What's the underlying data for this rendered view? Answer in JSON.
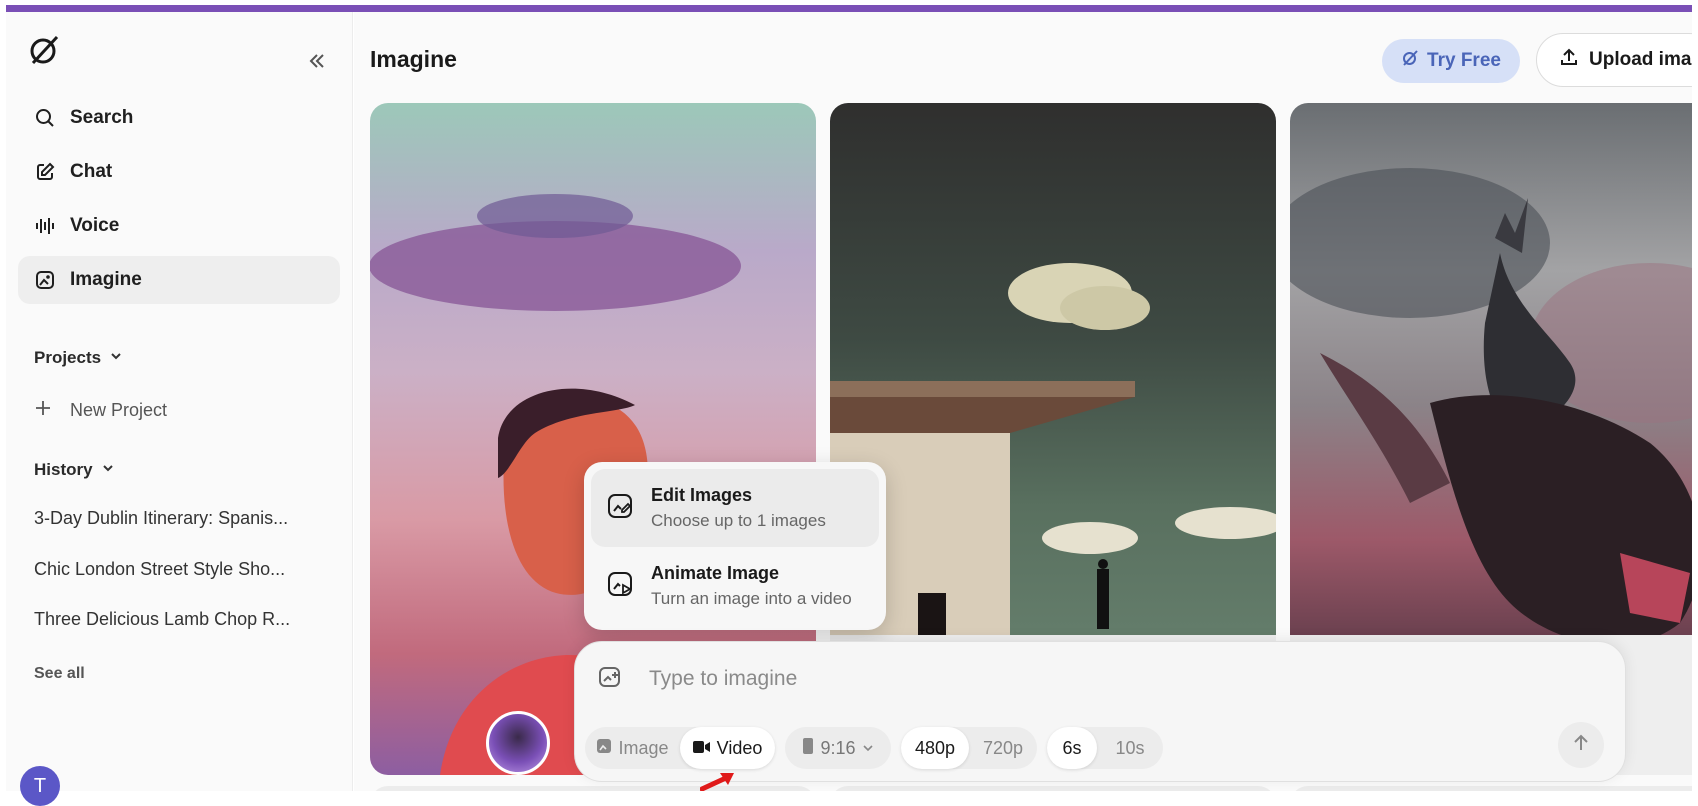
{
  "sidebar": {
    "nav": [
      {
        "label": "Search",
        "icon": "search-icon"
      },
      {
        "label": "Chat",
        "icon": "chat-edit-icon"
      },
      {
        "label": "Voice",
        "icon": "voice-wave-icon"
      },
      {
        "label": "Imagine",
        "icon": "imagine-icon",
        "active": true
      }
    ],
    "projects_label": "Projects",
    "new_project_label": "New Project",
    "history_label": "History",
    "history_items": [
      "3-Day Dublin Itinerary: Spanis...",
      "Chic London Street Style Sho...",
      "Three Delicious Lamb Chop R..."
    ],
    "see_all_label": "See all",
    "user_initial": "T"
  },
  "header": {
    "title": "Imagine",
    "try_free_label": "Try Free",
    "upload_label": "Upload image"
  },
  "menu": {
    "items": [
      {
        "title": "Edit Images",
        "subtitle": "Choose up to 1 images"
      },
      {
        "title": "Animate Image",
        "subtitle": "Turn an image into a video"
      }
    ]
  },
  "composer": {
    "placeholder": "Type to imagine",
    "mode": {
      "image_label": "Image",
      "video_label": "Video",
      "selected": "Video"
    },
    "aspect_label": "9:16",
    "resolution": {
      "options": [
        "480p",
        "720p"
      ],
      "selected": "480p"
    },
    "duration": {
      "options": [
        "6s",
        "10s"
      ],
      "selected": "6s"
    }
  },
  "colors": {
    "accent_strip": "#7a4fb6",
    "try_free_bg": "#d6e0f7",
    "try_free_text": "#4a65b8",
    "arrow": "#e01a1a"
  }
}
